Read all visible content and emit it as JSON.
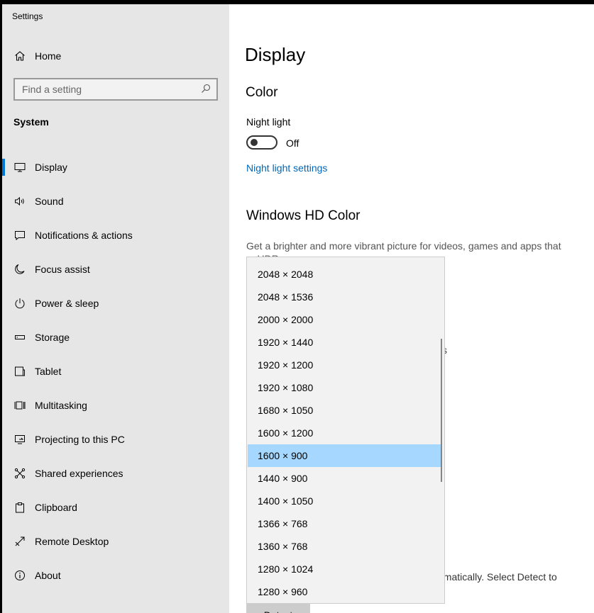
{
  "app": {
    "title": "Settings"
  },
  "sidebar": {
    "home_label": "Home",
    "search_placeholder": "Find a setting",
    "section_label": "System",
    "items": [
      {
        "label": "Display",
        "icon": "monitor-icon",
        "active": true
      },
      {
        "label": "Sound",
        "icon": "speaker-icon"
      },
      {
        "label": "Notifications & actions",
        "icon": "message-icon"
      },
      {
        "label": "Focus assist",
        "icon": "moon-icon"
      },
      {
        "label": "Power & sleep",
        "icon": "power-icon"
      },
      {
        "label": "Storage",
        "icon": "storage-icon"
      },
      {
        "label": "Tablet",
        "icon": "tablet-icon"
      },
      {
        "label": "Multitasking",
        "icon": "multitasking-icon"
      },
      {
        "label": "Projecting to this PC",
        "icon": "projector-icon"
      },
      {
        "label": "Shared experiences",
        "icon": "share-icon"
      },
      {
        "label": "Clipboard",
        "icon": "clipboard-icon"
      },
      {
        "label": "Remote Desktop",
        "icon": "remote-desktop-icon"
      },
      {
        "label": "About",
        "icon": "info-icon"
      }
    ]
  },
  "main": {
    "title": "Display",
    "color_heading": "Color",
    "night_light_label": "Night light",
    "night_light_state": "Off",
    "night_light_link": "Night light settings",
    "hd_heading": "Windows HD Color",
    "hd_description": "Get a brighter and more vibrant picture for videos, games and apps that",
    "hd_description_partial": "... HDR",
    "partial_text": "s",
    "detect_description": "ematically. Select Detect to",
    "detect_button": "Detect"
  },
  "resolution_dropdown": {
    "selected": "1600 × 900",
    "options": [
      "2048 × 2048",
      "2048 × 1536",
      "2000 × 2000",
      "1920 × 1440",
      "1920 × 1200",
      "1920 × 1080",
      "1680 × 1050",
      "1600 × 1200",
      "1600 × 900",
      "1440 × 900",
      "1400 × 1050",
      "1366 × 768",
      "1360 × 768",
      "1280 × 1024",
      "1280 × 960"
    ]
  },
  "colors": {
    "accent": "#0078d7",
    "link": "#0067b8",
    "selection": "#a6d8ff",
    "sidebar_bg": "#e6e6e6"
  }
}
